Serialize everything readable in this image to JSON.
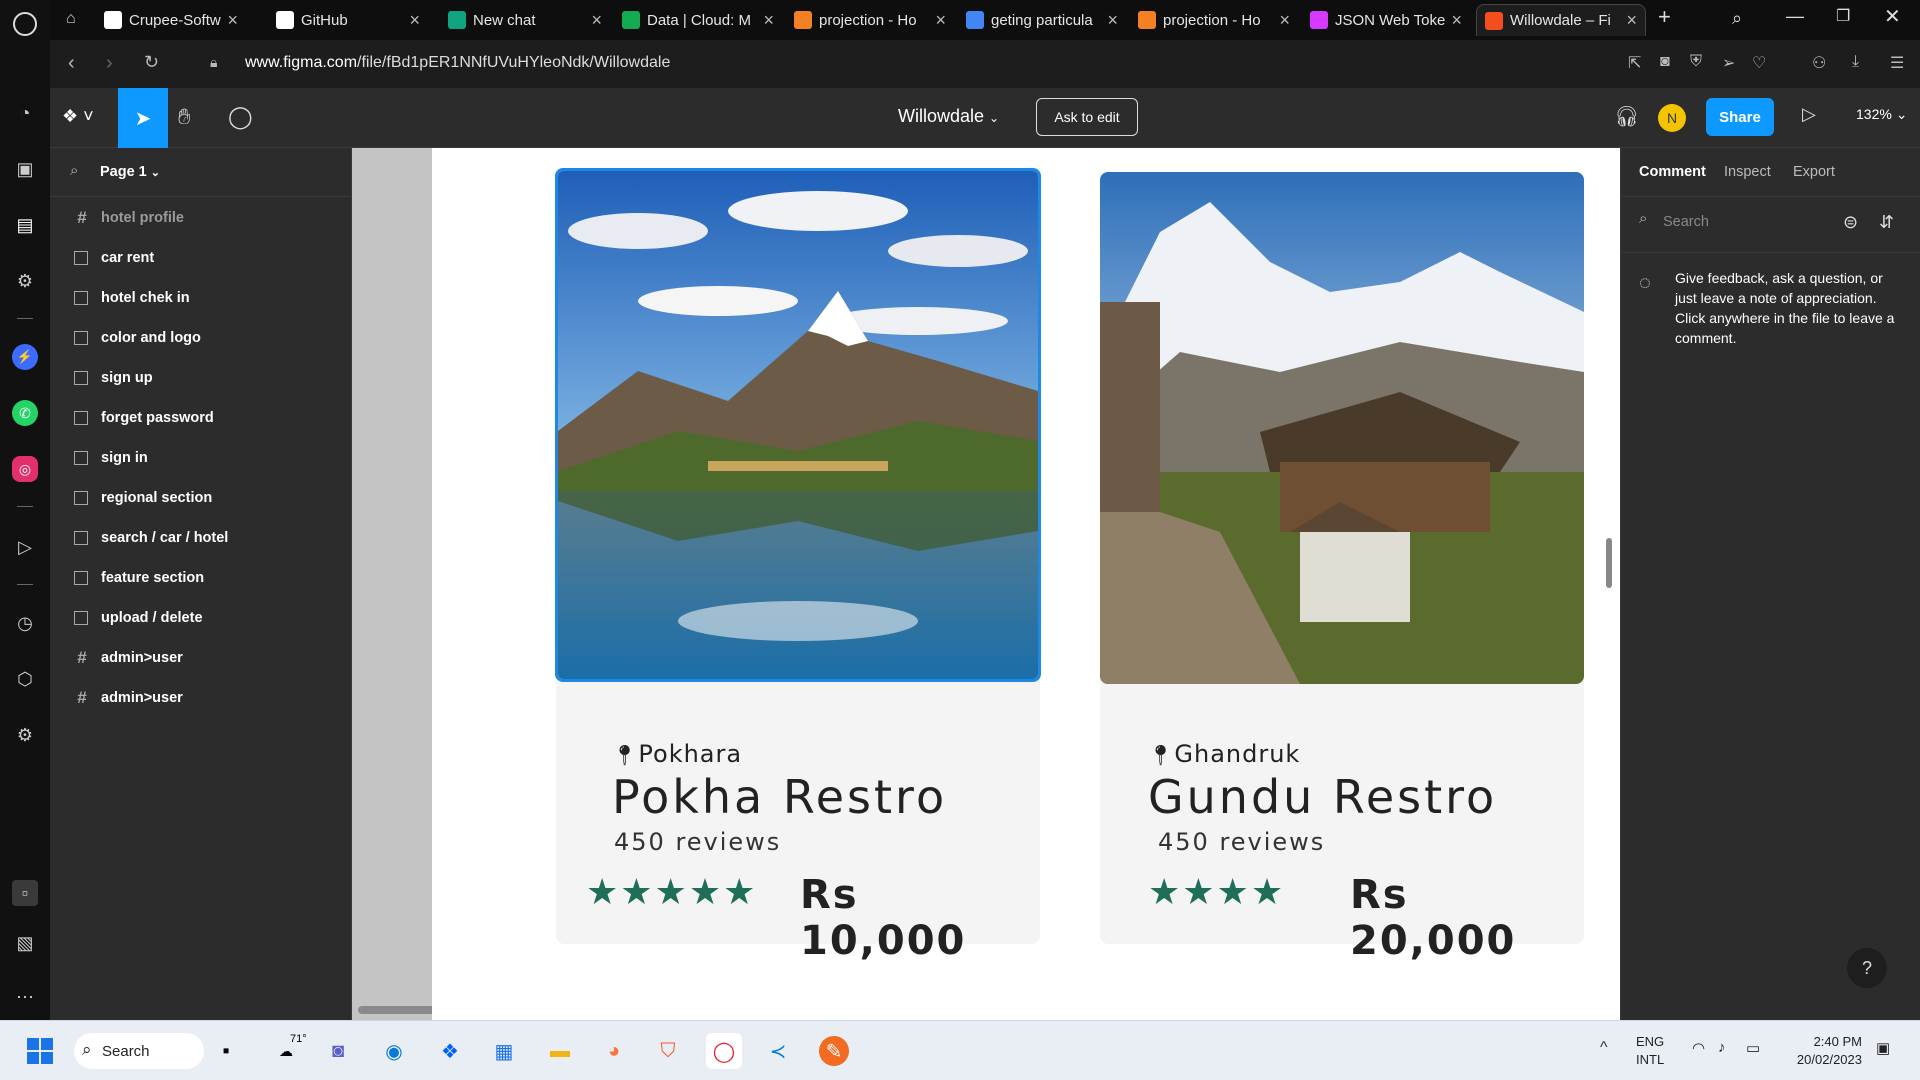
{
  "browser": {
    "tabs": [
      {
        "title": "Crupee-Softwar",
        "favicon": "github-icon"
      },
      {
        "title": "GitHub",
        "favicon": "github-icon"
      },
      {
        "title": "New chat",
        "favicon": "chatgpt-icon"
      },
      {
        "title": "Data | Cloud: M",
        "favicon": "mongodb-icon"
      },
      {
        "title": "projection - Ho",
        "favicon": "stackoverflow-icon"
      },
      {
        "title": "geting particula",
        "favicon": "google-icon"
      },
      {
        "title": "projection - Ho",
        "favicon": "stackoverflow-icon"
      },
      {
        "title": "JSON Web Toke",
        "favicon": "jwt-icon"
      },
      {
        "title": "Willowdale – Fi",
        "favicon": "figma-icon",
        "active": true
      }
    ],
    "url_prefix": "www.figma.com",
    "url_path": "/file/fBd1pER1NNfUVuHYleoNdk/Willowdale"
  },
  "figma": {
    "file_name": "Willowdale",
    "ask_to_edit": "Ask to edit",
    "avatar_initial": "N",
    "share_label": "Share",
    "zoom": "132%",
    "page_selector": "Page 1",
    "layers": [
      {
        "name": "hotel profile",
        "icon": "hash",
        "dim": true
      },
      {
        "name": "car rent",
        "icon": "frame"
      },
      {
        "name": "hotel chek in",
        "icon": "frame"
      },
      {
        "name": "color and logo",
        "icon": "frame"
      },
      {
        "name": "sign up",
        "icon": "frame"
      },
      {
        "name": "forget password",
        "icon": "frame"
      },
      {
        "name": "sign in",
        "icon": "frame"
      },
      {
        "name": "regional section",
        "icon": "frame"
      },
      {
        "name": "search / car / hotel",
        "icon": "frame"
      },
      {
        "name": "feature section",
        "icon": "frame"
      },
      {
        "name": "upload / delete",
        "icon": "frame"
      },
      {
        "name": "admin>user",
        "icon": "hash"
      },
      {
        "name": "admin>user",
        "icon": "hash"
      }
    ],
    "right_tabs": [
      "Comment",
      "Inspect",
      "Export"
    ],
    "search_placeholder": "Search",
    "comment_hint": "Give feedback, ask a question, or just leave a note of appreciation. Click anywhere in the file to leave a comment.",
    "help": "?"
  },
  "cards": [
    {
      "location": "Pokhara",
      "name": "Pokha Restro",
      "reviews": "450 reviews",
      "stars": "★★★★★",
      "rating": 5,
      "price": "Rs 10,000"
    },
    {
      "location": "Ghandruk",
      "name": "Gundu Restro",
      "reviews": "450 reviews",
      "stars": "★★★★",
      "rating": 4,
      "price": "Rs 20,000"
    }
  ],
  "taskbar": {
    "search_label": "Search",
    "weather": "71°",
    "lang_1": "ENG",
    "lang_2": "INTL",
    "time": "2:40 PM",
    "date": "20/02/2023"
  }
}
